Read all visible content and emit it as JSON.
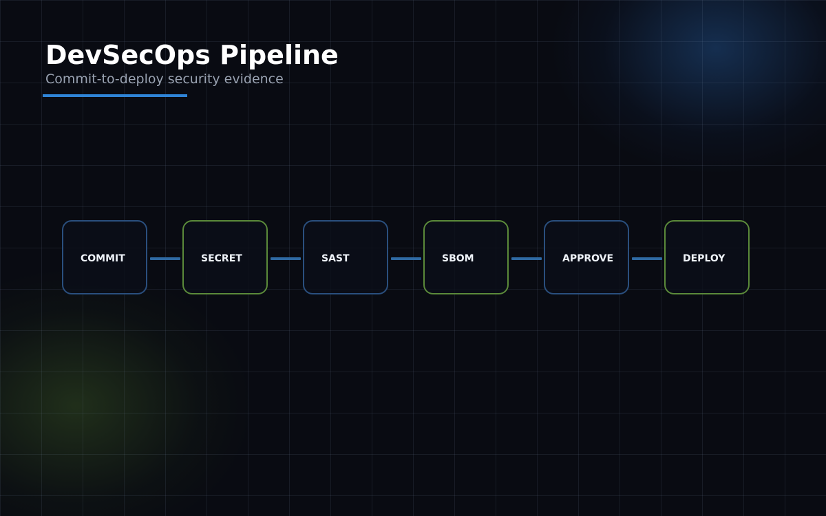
{
  "header": {
    "title": "DevSecOps Pipeline",
    "subtitle": "Commit-to-deploy security evidence"
  },
  "pipeline": {
    "stages": [
      {
        "label": "COMMIT",
        "accent": "#2a4f7e"
      },
      {
        "label": "SECRET",
        "accent": "#5b8a3a"
      },
      {
        "label": "SAST",
        "accent": "#2a4f7e"
      },
      {
        "label": "SBOM",
        "accent": "#5b8a3a"
      },
      {
        "label": "APPROVE",
        "accent": "#2a4f7e"
      },
      {
        "label": "DEPLOY",
        "accent": "#5b8a3a"
      }
    ],
    "connector_color": "#2f6aa3"
  },
  "colors": {
    "background": "#090b12",
    "accent_blue": "#2f84d6",
    "glow_blue": "#265fa5",
    "glow_green": "#46692a"
  }
}
